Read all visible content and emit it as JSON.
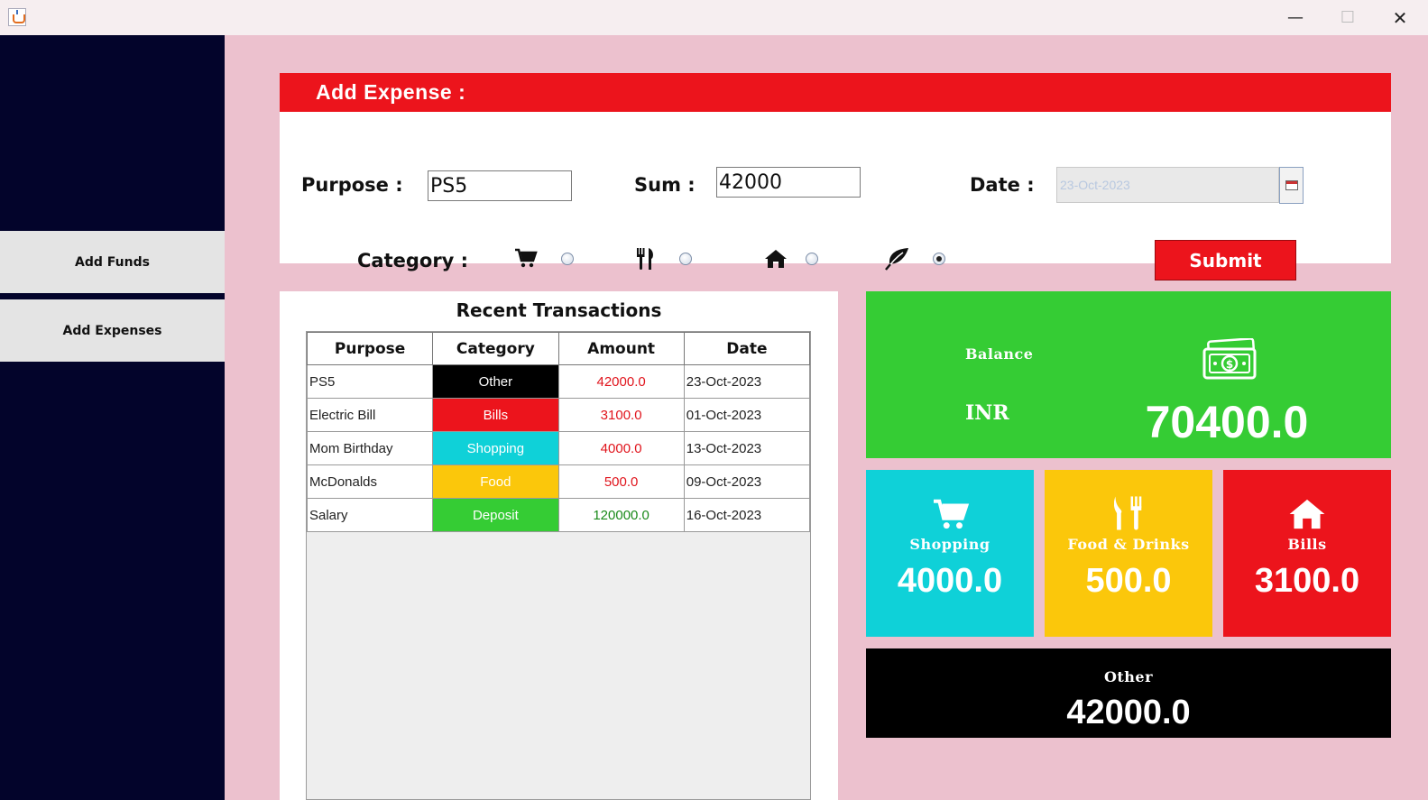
{
  "window": {
    "minimize": "—",
    "maximize": "☐",
    "close": "✕"
  },
  "sidebar": {
    "items": [
      {
        "label": "Add Funds"
      },
      {
        "label": "Add Expenses"
      }
    ]
  },
  "form": {
    "header": "Add Expense :",
    "purpose_label": "Purpose :",
    "purpose_value": "PS5",
    "sum_label": "Sum :",
    "sum_value": "42000",
    "date_label": "Date :",
    "date_value": "23-Oct-2023",
    "category_label": "Category :",
    "categories": [
      {
        "icon": "cart-icon",
        "selected": false
      },
      {
        "icon": "fork-knife-icon",
        "selected": false
      },
      {
        "icon": "home-icon",
        "selected": false
      },
      {
        "icon": "leaf-icon",
        "selected": true
      }
    ],
    "submit_label": "Submit"
  },
  "transactions": {
    "title": "Recent Transactions",
    "columns": [
      "Purpose",
      "Category",
      "Amount",
      "Date"
    ],
    "rows": [
      {
        "purpose": "PS5",
        "category": "Other",
        "amount": "42000.0",
        "date": "23-Oct-2023",
        "cat_color": "#000000",
        "amt_color": "#e0141c"
      },
      {
        "purpose": "Electric Bill",
        "category": "Bills",
        "amount": "3100.0",
        "date": "01-Oct-2023",
        "cat_color": "#ec141c",
        "amt_color": "#e0141c"
      },
      {
        "purpose": "Mom Birthday",
        "category": "Shopping",
        "amount": "4000.0",
        "date": "13-Oct-2023",
        "cat_color": "#0fd1d8",
        "amt_color": "#e0141c"
      },
      {
        "purpose": "McDonalds",
        "category": "Food",
        "amount": "500.0",
        "date": "09-Oct-2023",
        "cat_color": "#fbc70b",
        "amt_color": "#e0141c"
      },
      {
        "purpose": "Salary",
        "category": "Deposit",
        "amount": "120000.0",
        "date": "16-Oct-2023",
        "cat_color": "#35cc34",
        "amt_color": "#1a8a1a"
      }
    ]
  },
  "stats": {
    "balance": {
      "label": "Balance",
      "currency": "INR",
      "value": "70400.0",
      "icon": "money-icon",
      "color": "#35cc34"
    },
    "shopping": {
      "label": "Shopping",
      "value": "4000.0",
      "icon": "cart-icon",
      "color": "#0fd1d8"
    },
    "food": {
      "label": "Food & Drinks",
      "value": "500.0",
      "icon": "fork-knife-icon",
      "color": "#fbc70b"
    },
    "bills": {
      "label": "Bills",
      "value": "3100.0",
      "icon": "home-icon",
      "color": "#ec141c"
    },
    "other": {
      "label": "Other",
      "value": "42000.0",
      "color": "#000000"
    }
  }
}
